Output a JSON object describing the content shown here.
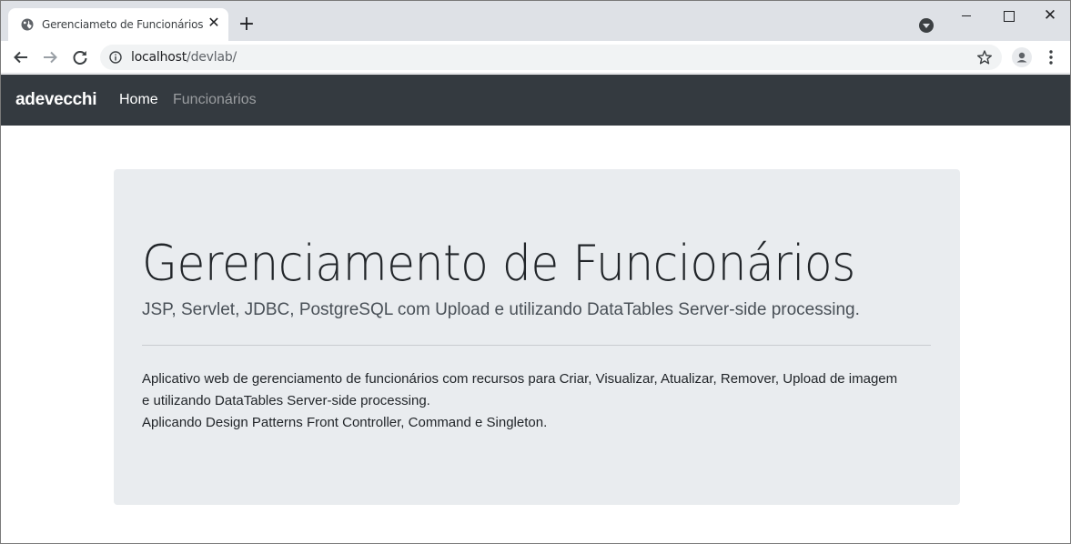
{
  "browser": {
    "tab_title": "Gerenciameto de Funcionários",
    "tab_close": "✕",
    "new_tab": "+",
    "url_host": "localhost",
    "url_path": "/devlab/",
    "win_close": "✕"
  },
  "navbar": {
    "brand": "adevecchi",
    "links": [
      "Home",
      "Funcionários"
    ]
  },
  "jumbotron": {
    "title": "Gerenciamento de Funcionários",
    "lead": "JSP, Servlet, JDBC, PostgreSQL com Upload e utilizando DataTables Server-side processing.",
    "description_line1": "Aplicativo web de gerenciamento de funcionários com recursos para Criar, Visualizar, Atualizar, Remover, Upload de imagem e utilizando DataTables Server-side processing.",
    "description_line2": "Aplicando Design Patterns Front Controller, Command e Singleton."
  },
  "colors": {
    "navbar_bg": "#343a40",
    "jumbotron_bg": "#e9ecef",
    "tabstrip_bg": "#dee1e6"
  }
}
